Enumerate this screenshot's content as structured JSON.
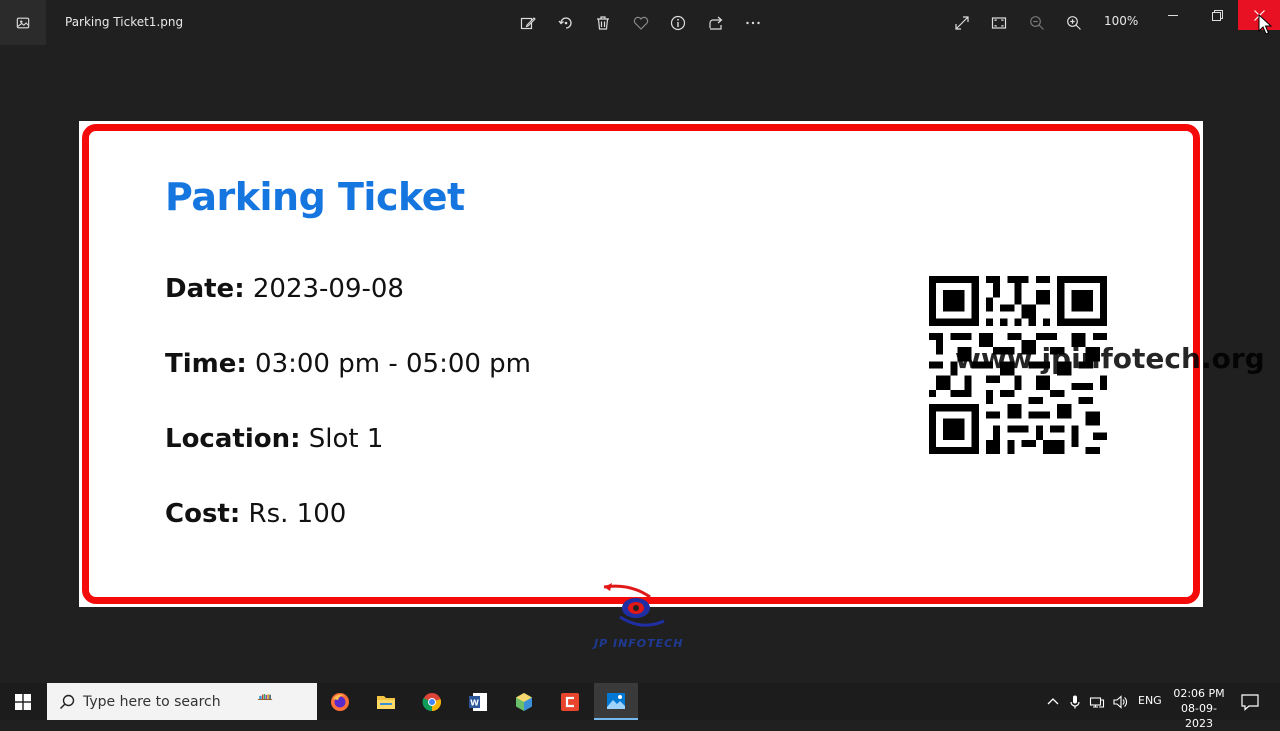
{
  "window": {
    "file_name": "Parking Ticket1.png",
    "zoom_level": "100%"
  },
  "toolbar": {
    "icons": [
      "edit-image-icon",
      "rotate-icon",
      "delete-icon",
      "favorite-icon",
      "info-icon",
      "share-icon",
      "more-icon"
    ],
    "right_icons": [
      "fullscreen-icon",
      "fit-to-window-icon",
      "zoom-out-icon",
      "zoom-in-icon"
    ]
  },
  "ticket": {
    "title": "Parking Ticket",
    "fields": [
      {
        "label": "Date:",
        "value": "2023-09-08"
      },
      {
        "label": "Time:",
        "value": "03:00 pm - 05:00 pm"
      },
      {
        "label": "Location:",
        "value": "Slot 1"
      },
      {
        "label": "Cost:",
        "value": "Rs. 100"
      }
    ],
    "watermark": "www.jpinfotech.org"
  },
  "logo": {
    "text": "JP INFOTECH"
  },
  "taskbar": {
    "search_placeholder": "Type here to search",
    "apps": [
      "firefox-icon",
      "file-explorer-icon",
      "chrome-icon",
      "word-icon",
      "app-cube-icon",
      "app-red-icon",
      "photos-icon"
    ],
    "language": "ENG",
    "time": "02:06 PM",
    "date": "08-09-2023"
  },
  "colors": {
    "ticket_border": "#f50a0a",
    "ticket_title": "#1676e0",
    "close_button": "#e81123"
  }
}
